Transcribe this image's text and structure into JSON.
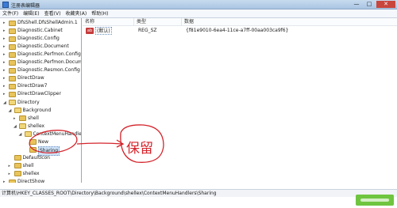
{
  "window": {
    "title": "注册表编辑器",
    "controls": {
      "minimize": "—",
      "maximize": "□",
      "close": "✕"
    }
  },
  "menu": [
    "文件(F)",
    "编辑(E)",
    "查看(V)",
    "收藏夹(A)",
    "帮助(H)"
  ],
  "tree": [
    {
      "label": "DfsShell.DfsShellAdmin.1",
      "indent": 0,
      "expander": "▸",
      "open": false
    },
    {
      "label": "Diagnostic.Cabinet",
      "indent": 0,
      "expander": "▸",
      "open": false
    },
    {
      "label": "Diagnostic.Config",
      "indent": 0,
      "expander": "▸",
      "open": false
    },
    {
      "label": "Diagnostic.Document",
      "indent": 0,
      "expander": "▸",
      "open": false
    },
    {
      "label": "Diagnostic.Perfmon.Config",
      "indent": 0,
      "expander": "▸",
      "open": false
    },
    {
      "label": "Diagnostic.Perfmon.Document",
      "indent": 0,
      "expander": "▸",
      "open": false
    },
    {
      "label": "Diagnostic.Resmon.Config",
      "indent": 0,
      "expander": "▸",
      "open": false
    },
    {
      "label": "DirectDraw",
      "indent": 0,
      "expander": "▸",
      "open": false
    },
    {
      "label": "DirectDraw7",
      "indent": 0,
      "expander": "▸",
      "open": false
    },
    {
      "label": "DirectDrawClipper",
      "indent": 0,
      "expander": "▸",
      "open": false
    },
    {
      "label": "Directory",
      "indent": 0,
      "expander": "◢",
      "open": true
    },
    {
      "label": "Background",
      "indent": 1,
      "expander": "◢",
      "open": true
    },
    {
      "label": "shell",
      "indent": 2,
      "expander": "▸",
      "open": false
    },
    {
      "label": "shellex",
      "indent": 2,
      "expander": "◢",
      "open": true
    },
    {
      "label": "ContextMenuHandlers",
      "indent": 3,
      "expander": "◢",
      "open": true
    },
    {
      "label": "New",
      "indent": 4,
      "expander": "",
      "open": false
    },
    {
      "label": "Sharing",
      "indent": 4,
      "expander": "",
      "open": false,
      "selected": true
    },
    {
      "label": "DefaultIcon",
      "indent": 1,
      "expander": "",
      "open": false
    },
    {
      "label": "shell",
      "indent": 1,
      "expander": "▸",
      "open": false
    },
    {
      "label": "shellex",
      "indent": 1,
      "expander": "▸",
      "open": false
    },
    {
      "label": "DirectShow",
      "indent": 0,
      "expander": "▸",
      "open": false
    }
  ],
  "values_pane": {
    "columns": [
      "名称",
      "类型",
      "数据"
    ],
    "rows": [
      {
        "icon": "ab",
        "name": "(默认)",
        "type": "REG_SZ",
        "data": "{f81e9010-6ea4-11ce-a7ff-00aa003ca9f6}"
      }
    ]
  },
  "status": "计算机\\HKEY_CLASSES_ROOT\\Directory\\Background\\shellex\\ContextMenuHandlers\\Sharing",
  "annotation": {
    "text": "保留",
    "color": "#d4232a",
    "marks": [
      "red-ellipse-around-new-and-sharing",
      "red-arrow",
      "red-circle-around-text"
    ]
  },
  "colors": {
    "accent": "#3a7bd5",
    "folder": "#e8c45a",
    "annotation": "#d4232a"
  }
}
